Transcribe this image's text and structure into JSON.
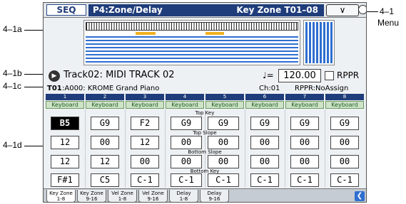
{
  "callouts": {
    "a": "4–1a",
    "b": "4–1b",
    "c": "4–1c",
    "d": "4–1d",
    "menu_num": "4–1",
    "menu_word": "Menu"
  },
  "header": {
    "mode": "SEQ",
    "page": "P4:Zone/Delay",
    "tab_title": "Key Zone T01–08",
    "menu_glyph": "∨"
  },
  "track": {
    "label": "Track02: MIDI TRACK 02",
    "tempo_symbol": "♩=",
    "tempo": "120.00",
    "rppr_label": "RPPR"
  },
  "program": {
    "track": "T01",
    "name": ":A000: KROME Grand Piano",
    "ch": "Ch:01",
    "rppr": "RPPR:NoAssign"
  },
  "tracks": {
    "numbers": [
      "1",
      "2",
      "3",
      "4",
      "5",
      "6",
      "7",
      "8"
    ],
    "type_label": "Keyboard"
  },
  "params": {
    "top_key_label": "Top Key",
    "top_slope_label": "Top Slope",
    "bottom_slope_label": "Bottom Slope",
    "bottom_key_label": "Bottom Key",
    "top_key": [
      "B5",
      "G9",
      "F2",
      "G9",
      "G9",
      "G9",
      "G9",
      "G9"
    ],
    "top_slope": [
      "12",
      "00",
      "12",
      "00",
      "00",
      "00",
      "00",
      "00"
    ],
    "bottom_slope": [
      "12",
      "12",
      "00",
      "00",
      "00",
      "00",
      "00",
      "00"
    ],
    "bottom_key": [
      "F#1",
      "C5",
      "C-1",
      "C-1",
      "C-1",
      "C-1",
      "C-1",
      "C-1"
    ]
  },
  "tabs": [
    {
      "l1": "Key Zone",
      "l2": "1-8"
    },
    {
      "l1": "Key Zone",
      "l2": "9-16"
    },
    {
      "l1": "Vel Zone",
      "l2": "1-8"
    },
    {
      "l1": "Vel Zone",
      "l2": "9-16"
    },
    {
      "l1": "Delay",
      "l2": "1-8"
    },
    {
      "l1": "Delay",
      "l2": "9-16"
    }
  ],
  "colors": {
    "header_blue": "#1f3d7a",
    "zone_orange": "#f2b01e",
    "zone_blue": "#2e6fd0",
    "keyboard_green": "#cfe3c9"
  }
}
